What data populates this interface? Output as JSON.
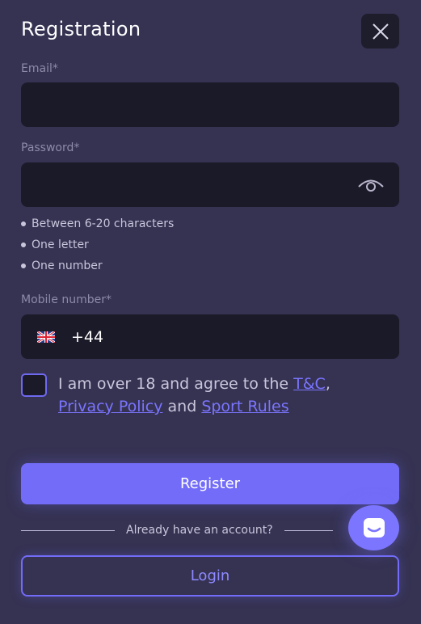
{
  "header": {
    "title": "Registration",
    "close_icon": "close-icon"
  },
  "email": {
    "label": "Email*",
    "value": ""
  },
  "password": {
    "label": "Password*",
    "value": "",
    "toggle_icon": "eye-icon",
    "rules": [
      "Between 6-20 characters",
      "One letter",
      "One number"
    ]
  },
  "mobile": {
    "label": "Mobile number*",
    "flag_icon": "uk-flag-icon",
    "country_code": "+44",
    "value": ""
  },
  "agreement": {
    "checked": false,
    "text_1": "I am over 18 and agree to the ",
    "tc_link": "T&C",
    "comma": ",",
    "privacy_link": "Privacy Policy",
    "and": " and ",
    "sport_rules_link": "Sport Rules"
  },
  "actions": {
    "register_label": "Register",
    "divider_text": "Already have an account?",
    "login_label": "Login"
  },
  "chat": {
    "icon": "chat-icon"
  },
  "colors": {
    "background": "#353252",
    "field": "#1b1a28",
    "accent": "#726cf8",
    "link": "#7b75ff"
  }
}
